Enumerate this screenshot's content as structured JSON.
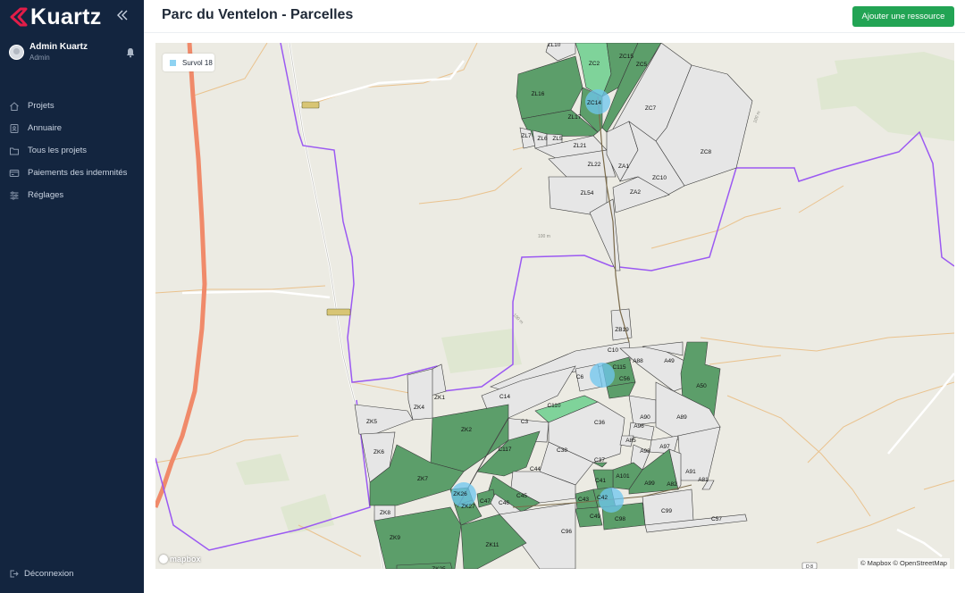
{
  "app": {
    "brand": "Kuartz",
    "accent": "#e11d48"
  },
  "user": {
    "name": "Admin Kuartz",
    "role": "Admin"
  },
  "nav": [
    {
      "label": "Projets",
      "icon": "home-icon"
    },
    {
      "label": "Annuaire",
      "icon": "contact-book-icon"
    },
    {
      "label": "Tous les projets",
      "icon": "folder-icon"
    },
    {
      "label": "Paiements des indemnités",
      "icon": "payment-icon"
    },
    {
      "label": "Réglages",
      "icon": "sliders-icon"
    }
  ],
  "logout_label": "Déconnexion",
  "header": {
    "title": "Parc du Ventelon - Parcelles",
    "add_button": "Ajouter une ressource"
  },
  "map": {
    "legend": {
      "label": "Survol 18",
      "color": "#8fd3f2"
    },
    "logo": "mapbox",
    "attribution": "© Mapbox © OpenStreetMap",
    "contour_labels": [
      "100 m",
      "100 m",
      "100 m"
    ],
    "road_label": "D 8",
    "parcels": [
      {
        "id": "ZL10",
        "fill": "#e6e6e6"
      },
      {
        "id": "ZC2",
        "fill": "#7fd39a"
      },
      {
        "id": "ZC15",
        "fill": "#5c9e6a"
      },
      {
        "id": "ZC5",
        "fill": "#5c9e6a"
      },
      {
        "id": "ZL16",
        "fill": "#5c9e6a"
      },
      {
        "id": "ZC14",
        "fill": "#5c9e6a"
      },
      {
        "id": "ZL17",
        "fill": "#5c9e6a"
      },
      {
        "id": "ZC7",
        "fill": "#e6e6e6"
      },
      {
        "id": "ZL7",
        "fill": "#e6e6e6"
      },
      {
        "id": "ZL6",
        "fill": "#e6e6e6"
      },
      {
        "id": "ZL5",
        "fill": "#e6e6e6"
      },
      {
        "id": "ZL21",
        "fill": "#e6e6e6"
      },
      {
        "id": "ZC8",
        "fill": "#e6e6e6"
      },
      {
        "id": "ZL22",
        "fill": "#e6e6e6"
      },
      {
        "id": "ZA1",
        "fill": "#e6e6e6"
      },
      {
        "id": "ZC10",
        "fill": "#e6e6e6"
      },
      {
        "id": "ZL54",
        "fill": "#e6e6e6"
      },
      {
        "id": "ZA2",
        "fill": "#e6e6e6"
      },
      {
        "id": "ZB19",
        "fill": "#e6e6e6"
      },
      {
        "id": "C10",
        "fill": "#e6e6e6"
      },
      {
        "id": "A88",
        "fill": "#e6e6e6"
      },
      {
        "id": "A49",
        "fill": "#e6e6e6"
      },
      {
        "id": "C115",
        "fill": "#5c9e6a"
      },
      {
        "id": "C6",
        "fill": "#e6e6e6"
      },
      {
        "id": "C56",
        "fill": "#5c9e6a"
      },
      {
        "id": "A50",
        "fill": "#5c9e6a"
      },
      {
        "id": "C14",
        "fill": "#e6e6e6"
      },
      {
        "id": "C110",
        "fill": "#7fd39a"
      },
      {
        "id": "ZK1",
        "fill": "#e6e6e6"
      },
      {
        "id": "ZK4",
        "fill": "#e6e6e6"
      },
      {
        "id": "C3",
        "fill": "#e6e6e6"
      },
      {
        "id": "C36",
        "fill": "#e6e6e6"
      },
      {
        "id": "A90",
        "fill": "#e6e6e6"
      },
      {
        "id": "A89",
        "fill": "#e6e6e6"
      },
      {
        "id": "ZK5",
        "fill": "#e6e6e6"
      },
      {
        "id": "ZK2",
        "fill": "#5c9e6a"
      },
      {
        "id": "A96",
        "fill": "#e6e6e6"
      },
      {
        "id": "A85",
        "fill": "#e6e6e6"
      },
      {
        "id": "A97",
        "fill": "#e6e6e6"
      },
      {
        "id": "C117",
        "fill": "#5c9e6a"
      },
      {
        "id": "C38",
        "fill": "#e6e6e6"
      },
      {
        "id": "A98",
        "fill": "#e6e6e6"
      },
      {
        "id": "ZK6",
        "fill": "#e6e6e6"
      },
      {
        "id": "C37",
        "fill": "#5c9e6a"
      },
      {
        "id": "A91",
        "fill": "#e6e6e6"
      },
      {
        "id": "C44",
        "fill": "#e6e6e6"
      },
      {
        "id": "A101",
        "fill": "#5c9e6a"
      },
      {
        "id": "A81",
        "fill": "#e6e6e6"
      },
      {
        "id": "ZK7",
        "fill": "#5c9e6a"
      },
      {
        "id": "C41",
        "fill": "#5c9e6a"
      },
      {
        "id": "A99",
        "fill": "#5c9e6a"
      },
      {
        "id": "A82",
        "fill": "#e6e6e6"
      },
      {
        "id": "ZK26",
        "fill": "#5c9e6a"
      },
      {
        "id": "C45",
        "fill": "#5c9e6a"
      },
      {
        "id": "C43",
        "fill": "#5c9e6a"
      },
      {
        "id": "C42",
        "fill": "#5c9e6a"
      },
      {
        "id": "ZK27",
        "fill": "#5c9e6a"
      },
      {
        "id": "C47",
        "fill": "#5c9e6a"
      },
      {
        "id": "C46",
        "fill": "#e6e6e6"
      },
      {
        "id": "C99",
        "fill": "#e6e6e6"
      },
      {
        "id": "ZK8",
        "fill": "#e6e6e6"
      },
      {
        "id": "C49",
        "fill": "#5c9e6a"
      },
      {
        "id": "C98",
        "fill": "#5c9e6a"
      },
      {
        "id": "C57",
        "fill": "#e6e6e6"
      },
      {
        "id": "ZK9",
        "fill": "#5c9e6a"
      },
      {
        "id": "C96",
        "fill": "#e6e6e6"
      },
      {
        "id": "ZK11",
        "fill": "#5c9e6a"
      },
      {
        "id": "ZK25",
        "fill": "#5c9e6a"
      }
    ]
  }
}
